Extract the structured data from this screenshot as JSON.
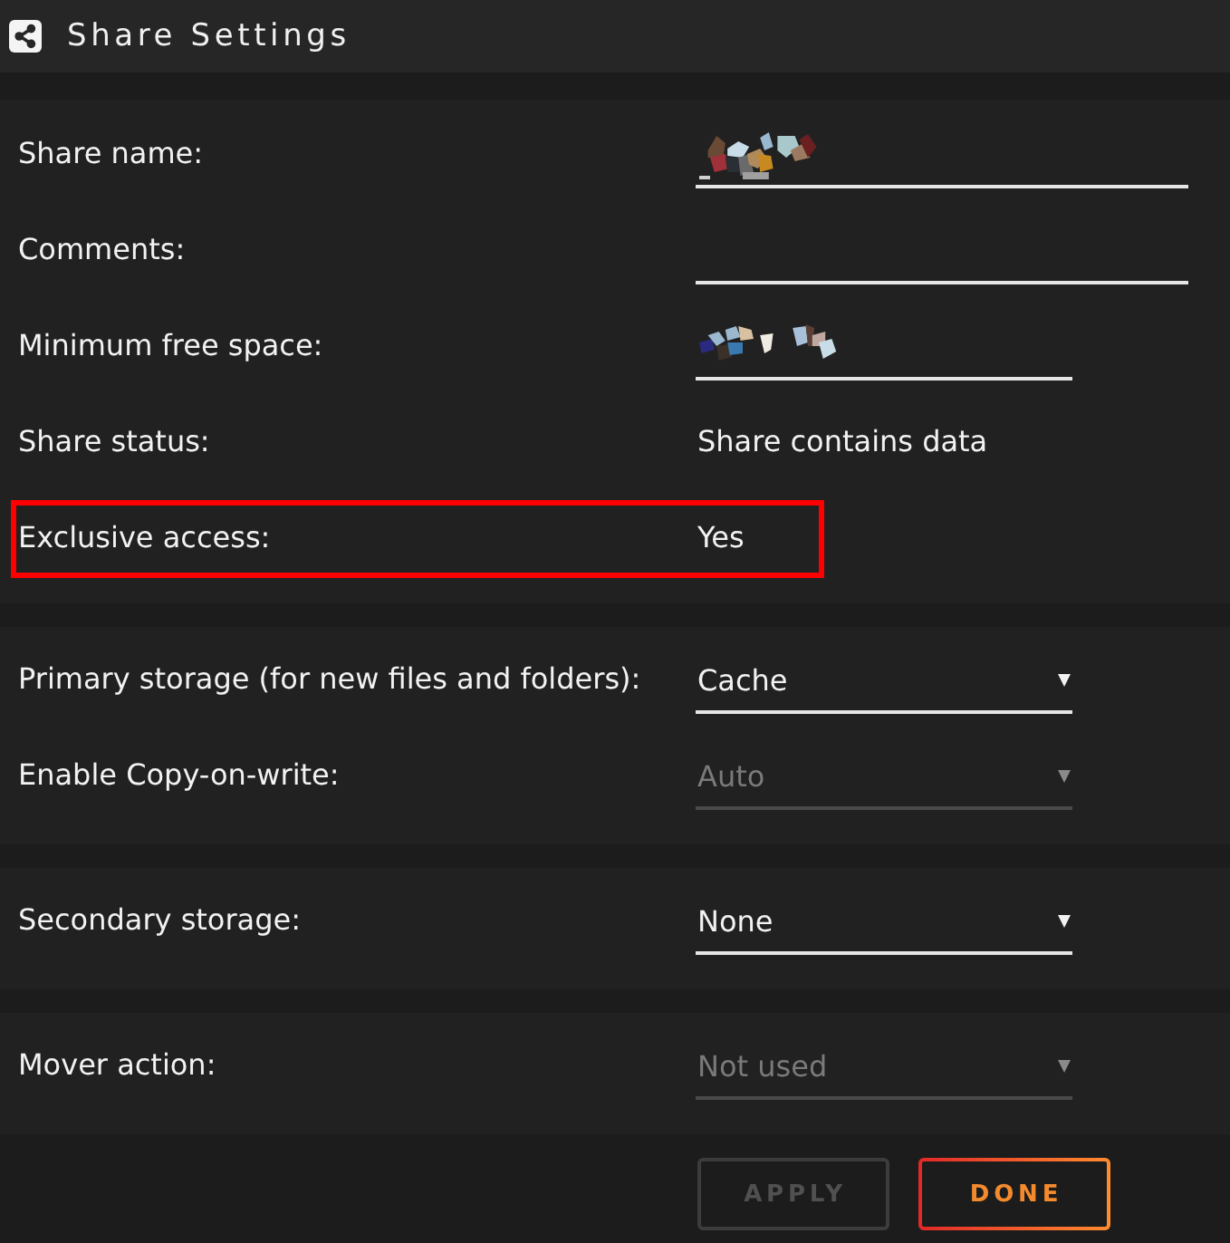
{
  "window": {
    "title": "Share Settings"
  },
  "sections": [
    {
      "rows": [
        {
          "kind": "text",
          "label": "Share name:",
          "obscured": true,
          "disabled": false,
          "highlighted": false
        },
        {
          "kind": "text",
          "label": "Comments:",
          "obscured": false,
          "disabled": false,
          "highlighted": false
        },
        {
          "kind": "size",
          "label": "Minimum free space:",
          "obscured": true,
          "disabled": false,
          "highlighted": false
        },
        {
          "kind": "static",
          "label": "Share status:",
          "value": "Share contains data",
          "disabled": false,
          "highlighted": false
        },
        {
          "kind": "static",
          "label": "Exclusive access:",
          "value": "Yes",
          "disabled": false,
          "highlighted": true
        }
      ]
    },
    {
      "rows": [
        {
          "kind": "select",
          "label": "Primary storage (for new files and folders):",
          "value": "Cache",
          "disabled": false,
          "highlighted": false
        },
        {
          "kind": "select",
          "label": "Enable Copy-on-write:",
          "value": "Auto",
          "disabled": true,
          "highlighted": false
        }
      ]
    },
    {
      "rows": [
        {
          "kind": "select",
          "label": "Secondary storage:",
          "value": "None",
          "disabled": false,
          "highlighted": false
        }
      ]
    },
    {
      "rows": [
        {
          "kind": "select",
          "label": "Mover action:",
          "value": "Not used",
          "disabled": true,
          "highlighted": false
        }
      ]
    }
  ],
  "buttons": [
    {
      "label": "APPLY",
      "disabled": true
    },
    {
      "label": "DONE",
      "disabled": false
    }
  ]
}
